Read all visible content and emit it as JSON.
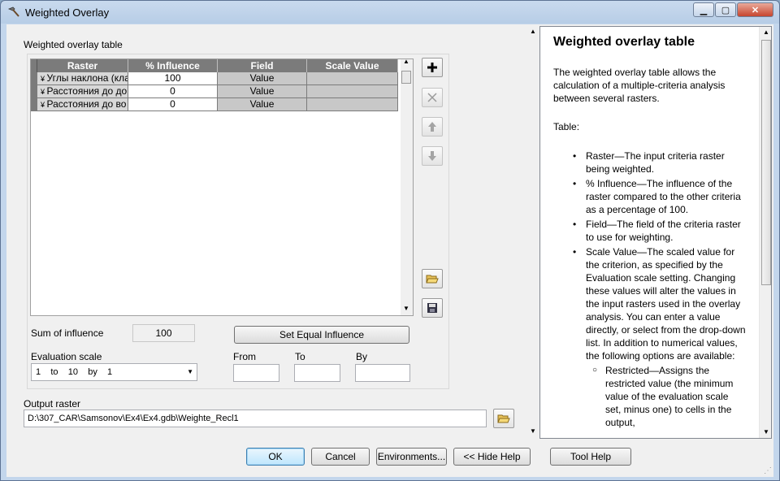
{
  "window": {
    "title": "Weighted Overlay"
  },
  "tool": {
    "table_label": "Weighted overlay table",
    "columns": [
      "Raster",
      "% Influence",
      "Field",
      "Scale Value"
    ],
    "rows": [
      {
        "raster": "Углы наклона (кла",
        "influence": "100",
        "field": "Value",
        "scale": ""
      },
      {
        "raster": "Расстояния до до",
        "influence": "0",
        "field": "Value",
        "scale": ""
      },
      {
        "raster": "Расстояния до во",
        "influence": "0",
        "field": "Value",
        "scale": ""
      }
    ],
    "sum_label": "Sum of influence",
    "sum_value": "100",
    "set_equal_label": "Set Equal Influence",
    "eval_label": "Evaluation scale",
    "eval_value": "1    to    10    by    1",
    "from_label": "From",
    "to_label": "To",
    "by_label": "By",
    "output_label": "Output raster",
    "output_value": "D:\\307_CAR\\Samsonov\\Ex4\\Ex4.gdb\\Weighte_Recl1"
  },
  "help": {
    "title": "Weighted overlay table",
    "intro": "The weighted overlay table allows the calculation of a multiple-criteria analysis between several rasters.",
    "table_heading": "Table:",
    "items": [
      "Raster—The input criteria raster being weighted.",
      "% Influence—The influence of the raster compared to the other criteria as a percentage of 100.",
      "Field—The field of the criteria raster to use for weighting.",
      "Scale Value—The scaled value for the criterion, as specified by the Evaluation scale setting. Changing these values will alter the values in the input rasters used in the overlay analysis. You can enter a value directly, or select from the drop-down list. In addition to numerical values, the following options are available:"
    ],
    "subitem": "Restricted—Assigns the restricted value (the minimum value of the evaluation scale set, minus one) to cells in the output,"
  },
  "buttons": {
    "ok": "OK",
    "cancel": "Cancel",
    "environments": "Environments...",
    "hide_help": "<< Hide Help",
    "tool_help": "Tool Help"
  }
}
